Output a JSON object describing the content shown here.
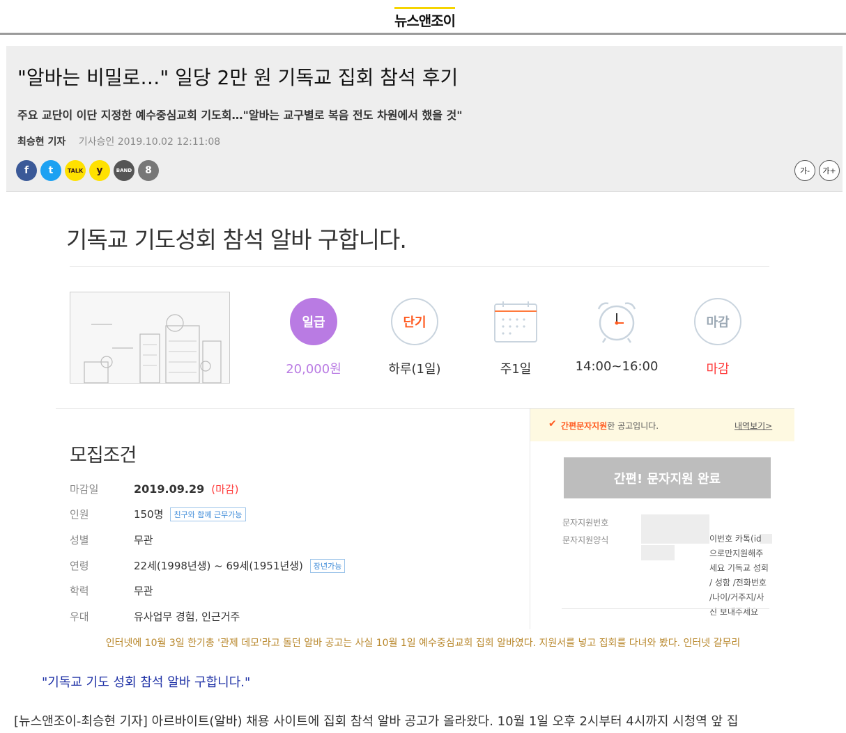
{
  "site": {
    "logo": "뉴스앤조이"
  },
  "article": {
    "headline": "\"알바는 비밀로…\" 일당 2만 원 기독교 집회 참석 후기",
    "subhead": "주요 교단이 이단 지정한 예수중심교회 기도회…\"알바는 교구별로 복음 전도 차원에서 했을 것\"",
    "author": "최승현 기자",
    "date": "기사승인 2019.10.02   12:11:08",
    "share_icons": [
      "facebook-icon",
      "twitter-icon",
      "kakaotalk-icon",
      "kakaostory-icon",
      "band-icon",
      "link-icon"
    ],
    "share_glyphs": {
      "facebook": "f",
      "twitter": "t",
      "kakaotalk": "TALK",
      "kakaostory": "y",
      "band": "BAND",
      "link": "8"
    },
    "font_small": "가-",
    "font_large": "가+",
    "caption": "인터넷에 10월 3일 한기총 '관제 데모'라고 돌던 알바 공고는 사실 10월 1일 예수중심교회 집회 알바였다. 지원서를 넣고 집회를 다녀와 봤다. 인터넷 갈무리",
    "quote": "\"기독교 기도 성회 참석 알바 구합니다.\"",
    "body_first_line": "[뉴스앤조이-최승현 기자] 아르바이트(알바) 채용 사이트에 집회 참석 알바 공고가 올라왔다. 10월 1일 오후 2시부터 4시까지 시청역 앞 집"
  },
  "job_posting": {
    "title": "기독교 기도성회 참석 알바 구합니다.",
    "icons": [
      {
        "circle": "일급",
        "value": "20,000원"
      },
      {
        "circle": "단기",
        "value": "하루(1일)"
      },
      {
        "circle": "calendar-icon",
        "value": "주1일"
      },
      {
        "circle": "alarm-clock-icon",
        "value": "14:00~16:00"
      },
      {
        "circle": "마감",
        "value": "마감"
      }
    ],
    "conditions_title": "모집조건",
    "conditions": [
      {
        "key": "마감일",
        "value": "2019.09.29",
        "extra": "(마감)"
      },
      {
        "key": "인원",
        "value": "150명",
        "tag": "친구와 함께 근무가능"
      },
      {
        "key": "성별",
        "value": "무관"
      },
      {
        "key": "연령",
        "value": "22세(1998년생) ~ 69세(1951년생)",
        "tag": "장년가능"
      },
      {
        "key": "학력",
        "value": "무관"
      },
      {
        "key": "우대",
        "value": "유사업무 경험, 인근거주"
      }
    ],
    "notice_highlight": "간편문자지원",
    "notice_rest": "한 공고입니다.",
    "notice_link": "내역보기>",
    "apply_button": "간편! 문자지원 완료",
    "sms_number_label": "문자지원번호",
    "sms_format_label": "문자지원양식",
    "sms_format_text": "이번호 카톡(id 으로만지원해주세요 기독교 성회 / 성함 /전화번호 /나이/거주지/사진 보내주세요"
  },
  "colors": {
    "accent_yellow": "#f5d400",
    "pay_purple": "#b97be3",
    "deadline_red": "#ff3b3b",
    "caption_gold": "#b8872b",
    "quote_blue": "#1c2fa5"
  }
}
